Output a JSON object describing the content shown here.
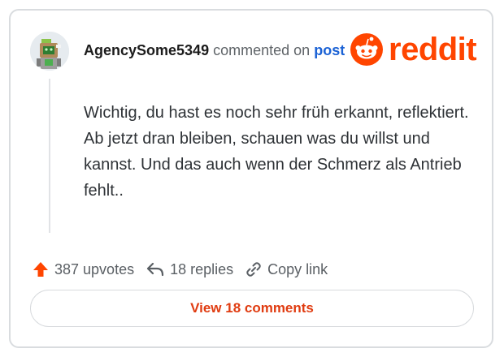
{
  "comment": {
    "username": "AgencySome5349",
    "action_text": "commented on",
    "post_link": "post",
    "body": "Wichtig, du hast es noch sehr früh erkannt, reflektiert. Ab jetzt dran bleiben, schauen was du willst und kannst. Und das auch wenn der Schmerz als Antrieb fehlt.."
  },
  "brand": {
    "wordmark": "reddit",
    "color": "#ff4500"
  },
  "actions": {
    "upvotes": "387 upvotes",
    "replies": "18 replies",
    "copy_link": "Copy link"
  },
  "view_button": "View 18 comments",
  "icons": [
    "avatar-robot",
    "reddit-snoo-icon",
    "upvote-arrow-icon",
    "reply-arrow-icon",
    "link-icon"
  ]
}
